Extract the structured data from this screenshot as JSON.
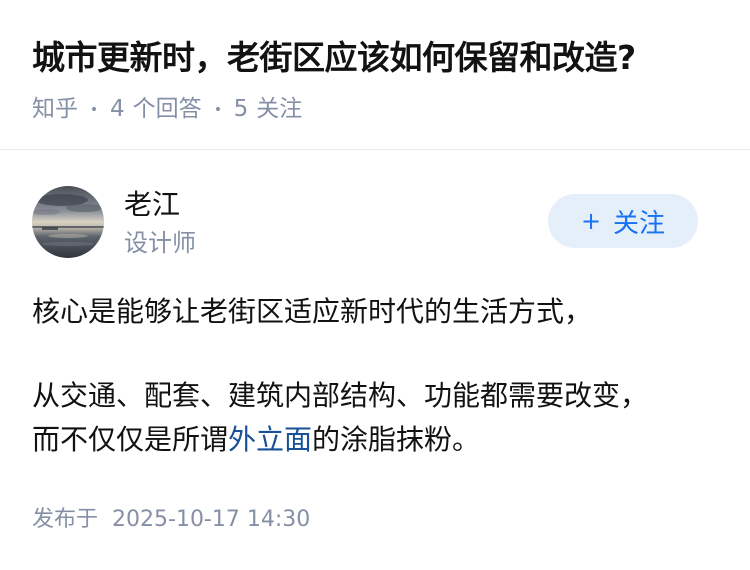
{
  "question": {
    "title": "城市更新时，老街区应该如何保留和改造?",
    "source": "知乎",
    "answer_count": "4",
    "answer_label": "个回答",
    "follower_count": "5",
    "follower_label": "关注"
  },
  "author": {
    "name": "老江",
    "description": "设计师",
    "avatar_icon": "avatar-sunset-photo",
    "follow_label": "关注",
    "follow_icon": "plus-icon"
  },
  "answer": {
    "paragraph1": "核心是能够让老街区适应新时代的生活方式，",
    "paragraph2_line1": "从交通、配套、建筑内部结构、功能都需要改变，",
    "paragraph2_pre": "而不仅仅是所谓",
    "paragraph2_link": "外立面",
    "paragraph2_post": "的涂脂抹粉。"
  },
  "footer": {
    "publish_label": "发布于",
    "publish_time": "2025-10-17 14:30"
  },
  "colors": {
    "meta_gray": "#8590a6",
    "link_blue": "#175199",
    "follow_blue": "#1772f6",
    "follow_bg": "#e5effa"
  }
}
